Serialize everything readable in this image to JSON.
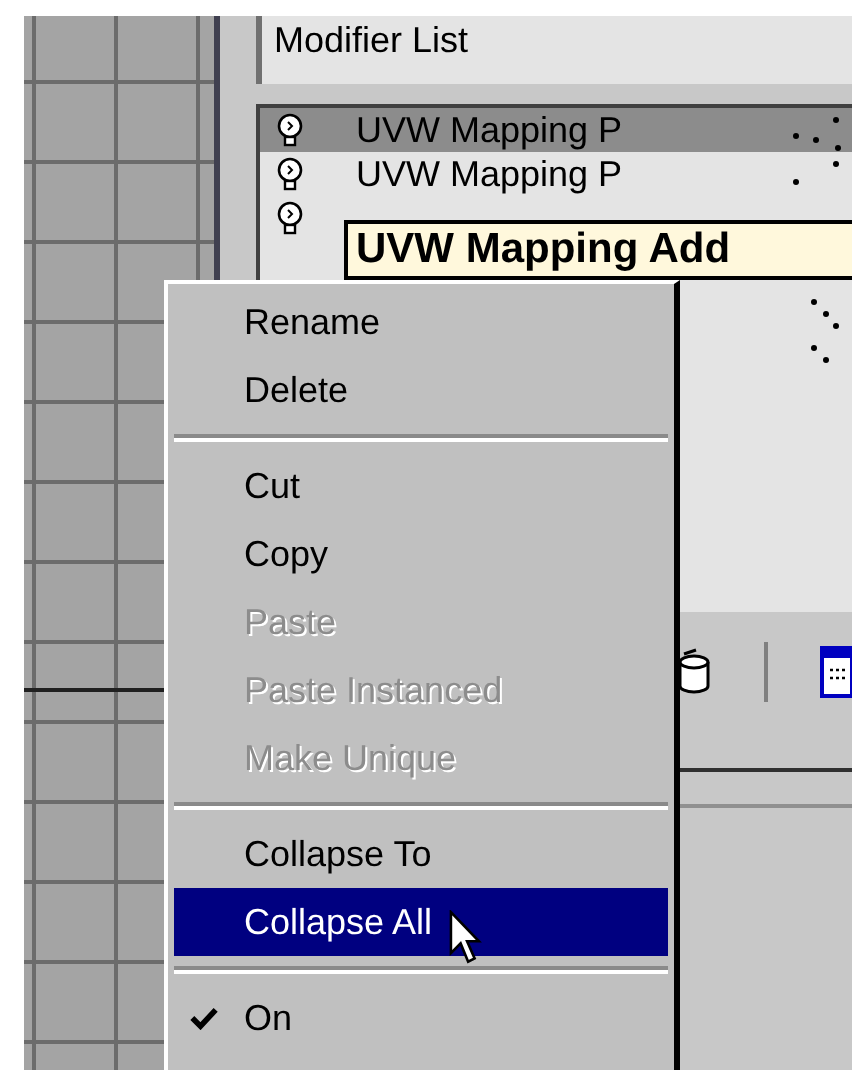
{
  "modifier_list": {
    "label": "Modifier List"
  },
  "stack": [
    {
      "name": "UVW Mapping P",
      "selected": true
    },
    {
      "name": "UVW Mapping P",
      "selected": false
    },
    {
      "selected": false
    }
  ],
  "tooltip": "UVW Mapping Add",
  "context_menu": [
    {
      "kind": "item",
      "label": "Rename",
      "disabled": false,
      "selected": false,
      "checked": false
    },
    {
      "kind": "item",
      "label": "Delete",
      "disabled": false,
      "selected": false,
      "checked": false
    },
    {
      "kind": "separator"
    },
    {
      "kind": "item",
      "label": "Cut",
      "disabled": false,
      "selected": false,
      "checked": false
    },
    {
      "kind": "item",
      "label": "Copy",
      "disabled": false,
      "selected": false,
      "checked": false
    },
    {
      "kind": "item",
      "label": "Paste",
      "disabled": true,
      "selected": false,
      "checked": false
    },
    {
      "kind": "item",
      "label": "Paste Instanced",
      "disabled": true,
      "selected": false,
      "checked": false
    },
    {
      "kind": "item",
      "label": "Make Unique",
      "disabled": true,
      "selected": false,
      "checked": false
    },
    {
      "kind": "separator"
    },
    {
      "kind": "item",
      "label": "Collapse To",
      "disabled": false,
      "selected": false,
      "checked": false
    },
    {
      "kind": "item",
      "label": "Collapse All",
      "disabled": false,
      "selected": true,
      "checked": false
    },
    {
      "kind": "separator"
    },
    {
      "kind": "item",
      "label": "On",
      "disabled": false,
      "selected": false,
      "checked": true
    }
  ]
}
